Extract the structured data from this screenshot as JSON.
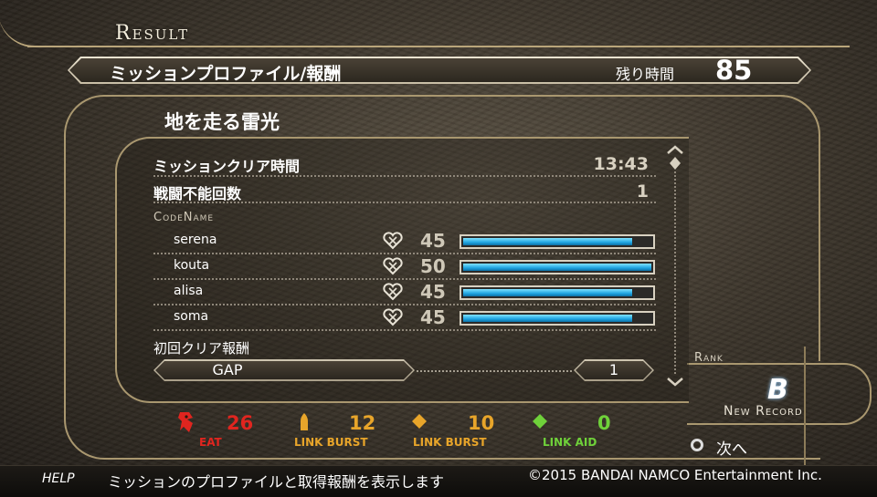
{
  "header": {
    "title": "Result",
    "banner_label": "ミッションプロファイル/報酬",
    "time_left_label": "残り時間",
    "time_left_value": "85"
  },
  "mission": {
    "name": "地を走る雷光",
    "clear_time_label": "ミッションクリア時間",
    "clear_time_value": "13:43",
    "incapacitated_label": "戦闘不能回数",
    "incapacitated_value": "1",
    "codename_header": "CodeName",
    "members": [
      {
        "name": "serena",
        "link_value": "45",
        "link_fraction": 0.9
      },
      {
        "name": "kouta",
        "link_value": "50",
        "link_fraction": 1.0
      },
      {
        "name": "alisa",
        "link_value": "45",
        "link_fraction": 0.9
      },
      {
        "name": "soma",
        "link_value": "45",
        "link_fraction": 0.9
      }
    ],
    "first_clear_label": "初回クリア報酬",
    "reward_name": "GAP",
    "reward_count": "1"
  },
  "rank": {
    "label": "Rank",
    "value": "B",
    "new_record": "New Record"
  },
  "stats": [
    {
      "value": "26",
      "label": "EAT",
      "color": "#e0251f",
      "icon": "devour-icon"
    },
    {
      "value": "12",
      "label": "LINK BURST",
      "color": "#e8a52a",
      "icon": "bullet-icon"
    },
    {
      "value": "10",
      "label": "LINK BURST",
      "color": "#e8a52a",
      "icon": "diamond-icon"
    },
    {
      "value": "0",
      "label": "LINK AID",
      "color": "#6fd13a",
      "icon": "green-diamond-icon"
    }
  ],
  "next": {
    "label": "次へ"
  },
  "footer": {
    "help_label": "HELP",
    "help_text": "ミッションのプロファイルと取得報酬を表示します",
    "copyright": "©2015 BANDAI NAMCO Entertainment Inc."
  }
}
